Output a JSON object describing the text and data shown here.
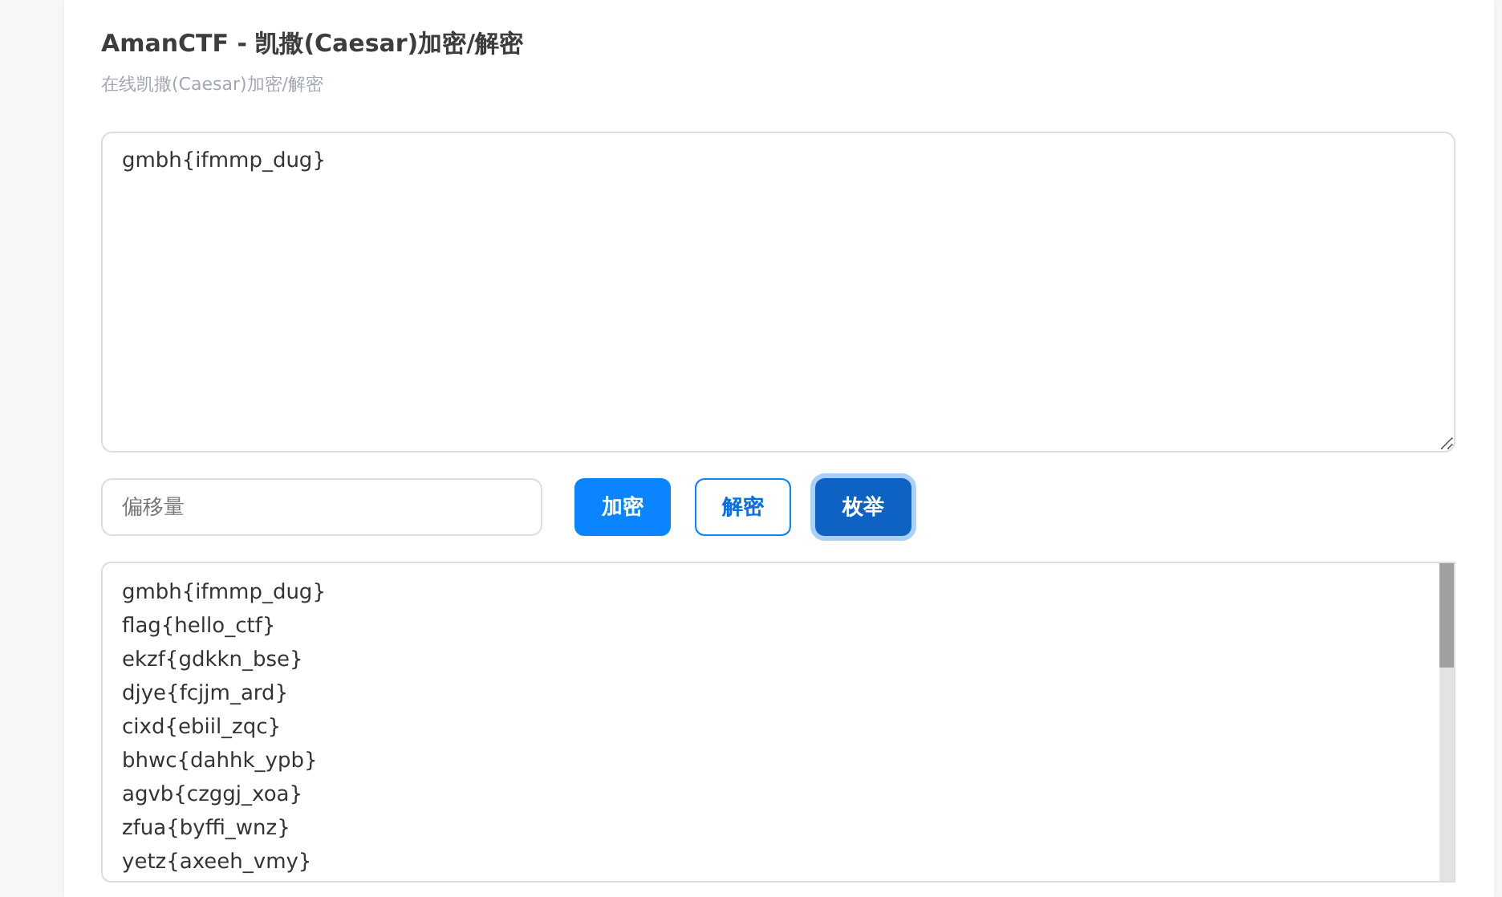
{
  "title": "AmanCTF - 凯撒(Caesar)加密/解密",
  "subtitle": "在线凯撒(Caesar)加密/解密",
  "input_text": "gmbh{ifmmp_dug}",
  "offset_field": {
    "placeholder": "偏移量"
  },
  "buttons": [
    {
      "label": "加密",
      "kind": "primary",
      "focused": false
    },
    {
      "label": "解密",
      "kind": "outline",
      "focused": false
    },
    {
      "label": "枚举",
      "kind": "dark",
      "focused": true
    }
  ],
  "output_lines": [
    "gmbh{ifmmp_dug}",
    "flag{hello_ctf}",
    "ekzf{gdkkn_bse}",
    "djye{fcjjm_ard}",
    "cixd{ebiil_zqc}",
    "bhwc{dahhk_ypb}",
    "agvb{czggj_xoa}",
    "zfua{byffi_wnz}",
    "yetz{axeeh_vmy}"
  ]
}
